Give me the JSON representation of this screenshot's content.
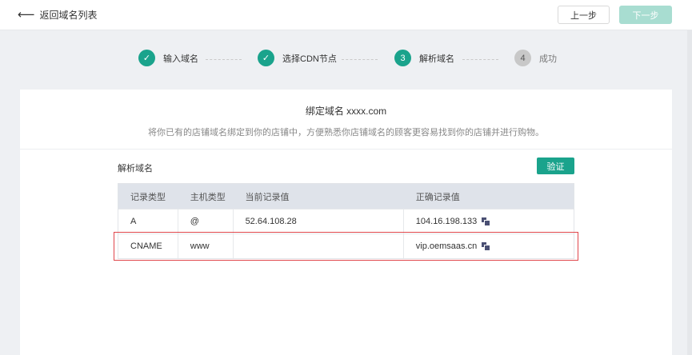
{
  "topbar": {
    "back_label": "返回域名列表",
    "prev_label": "上一步",
    "next_label": "下一步"
  },
  "steps": [
    {
      "num": "",
      "label": "输入域名",
      "state": "done"
    },
    {
      "num": "",
      "label": "选择CDN节点",
      "state": "done"
    },
    {
      "num": "3",
      "label": "解析域名",
      "state": "active"
    },
    {
      "num": "4",
      "label": "成功",
      "state": "todo"
    }
  ],
  "card": {
    "title": "绑定域名 xxxx.com",
    "subtitle": "将你已有的店铺域名绑定到你的店铺中，方便熟悉你店铺域名的顾客更容易找到你的店铺并进行购物。",
    "section_label": "解析域名",
    "verify_label": "验证"
  },
  "table": {
    "headers": [
      "记录类型",
      "主机类型",
      "当前记录值",
      "正确记录值"
    ],
    "rows": [
      [
        "A",
        "@",
        "52.64.108.28",
        "104.16.198.133"
      ],
      [
        "CNAME",
        "www",
        "",
        "vip.oemsaas.cn"
      ]
    ]
  },
  "colors": {
    "accent": "#1aa38c",
    "highlight": "#e0464b"
  }
}
